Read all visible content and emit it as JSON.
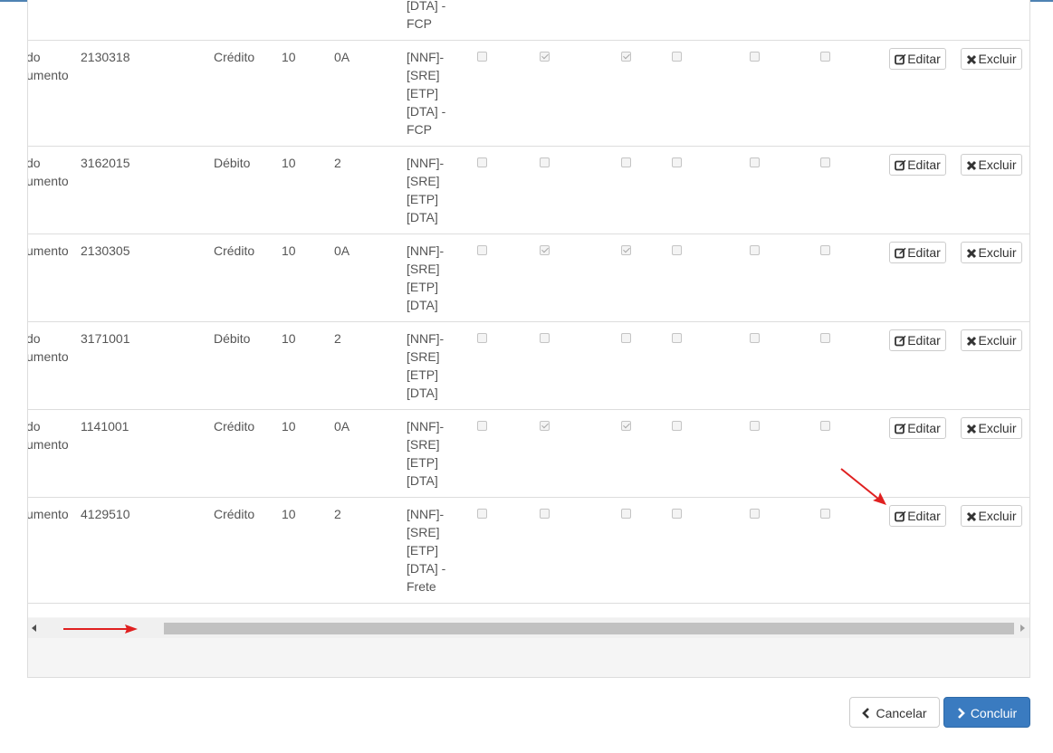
{
  "colors": {
    "accent": "#3a7bc0",
    "annotation": "#e02020",
    "border": "#dddddd"
  },
  "partial_top_row": {
    "tags": [
      "[DTA] -",
      "FCP"
    ]
  },
  "rows": [
    {
      "desc": [
        "do",
        "umento"
      ],
      "code": "2130318",
      "type": "Crédito",
      "n1": "10",
      "n2": "0A",
      "tags": [
        "[NNF]-",
        "[SRE]",
        "[ETP]",
        "[DTA] -",
        "FCP"
      ],
      "checks": [
        false,
        true,
        true,
        false,
        false,
        false
      ],
      "edit": "Editar",
      "delete": "Excluir"
    },
    {
      "desc": [
        "do",
        "umento"
      ],
      "code": "3162015",
      "type": "Débito",
      "n1": "10",
      "n2": "2",
      "tags": [
        "[NNF]-",
        "[SRE]",
        "[ETP]",
        "[DTA]"
      ],
      "checks": [
        false,
        false,
        false,
        false,
        false,
        false
      ],
      "edit": "Editar",
      "delete": "Excluir"
    },
    {
      "desc": [
        "umento"
      ],
      "code": "2130305",
      "type": "Crédito",
      "n1": "10",
      "n2": "0A",
      "tags": [
        "[NNF]-",
        "[SRE]",
        "[ETP]",
        "[DTA]"
      ],
      "checks": [
        false,
        true,
        true,
        false,
        false,
        false
      ],
      "edit": "Editar",
      "delete": "Excluir"
    },
    {
      "desc": [
        "do",
        "umento"
      ],
      "code": "3171001",
      "type": "Débito",
      "n1": "10",
      "n2": "2",
      "tags": [
        "[NNF]-",
        "[SRE]",
        "[ETP]",
        "[DTA]"
      ],
      "checks": [
        false,
        false,
        false,
        false,
        false,
        false
      ],
      "edit": "Editar",
      "delete": "Excluir"
    },
    {
      "desc": [
        "do",
        "umento"
      ],
      "code": "1141001",
      "type": "Crédito",
      "n1": "10",
      "n2": "0A",
      "tags": [
        "[NNF]-",
        "[SRE]",
        "[ETP]",
        "[DTA]"
      ],
      "checks": [
        false,
        true,
        true,
        false,
        false,
        false
      ],
      "edit": "Editar",
      "delete": "Excluir"
    },
    {
      "desc": [
        "umento"
      ],
      "code": "4129510",
      "type": "Crédito",
      "n1": "10",
      "n2": "2",
      "tags": [
        "[NNF]-",
        "[SRE]",
        "[ETP]",
        "[DTA] -",
        "Frete"
      ],
      "checks": [
        false,
        false,
        false,
        false,
        false,
        false
      ],
      "edit": "Editar",
      "delete": "Excluir"
    }
  ],
  "footer": {
    "cancel_label": "Cancelar",
    "confirm_label": "Concluir"
  },
  "icons": {
    "edit": "edit-icon",
    "delete": "times-icon",
    "cancel": "chevron-left-icon",
    "confirm": "chevron-right-icon"
  }
}
